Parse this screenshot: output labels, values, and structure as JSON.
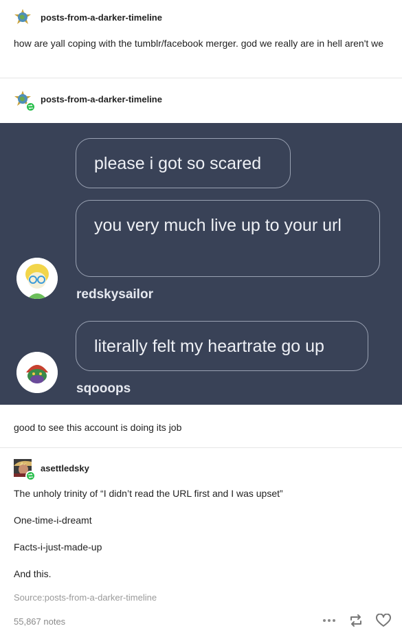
{
  "post1": {
    "username": "posts-from-a-darker-timeline",
    "text": "how are yall coping with the tumblr/facebook merger. god we really are in hell aren't we"
  },
  "post2": {
    "username": "posts-from-a-darker-timeline",
    "chat": {
      "messages": [
        "please i got so scared",
        "you very much live up to your url",
        "literally felt my heartrate go up"
      ],
      "senders": [
        "redskysailor",
        "sqooops"
      ]
    },
    "caption": "good to see this account is doing its job"
  },
  "post3": {
    "username": "asettledsky",
    "lines": [
      "The unholy trinity of “I didn’t read the URL first and I was upset”",
      "One-time-i-dreamt",
      "Facts-i-just-made-up",
      "And this."
    ]
  },
  "footer": {
    "source": "Source:posts-from-a-darker-timeline",
    "notes": "55,867 notes",
    "icons": [
      "more-icon",
      "reblog-icon",
      "heart-icon"
    ]
  },
  "colors": {
    "panel": "#394257",
    "reblog_badge": "#2bbf4e",
    "bubble_border": "#9aa2b3"
  }
}
